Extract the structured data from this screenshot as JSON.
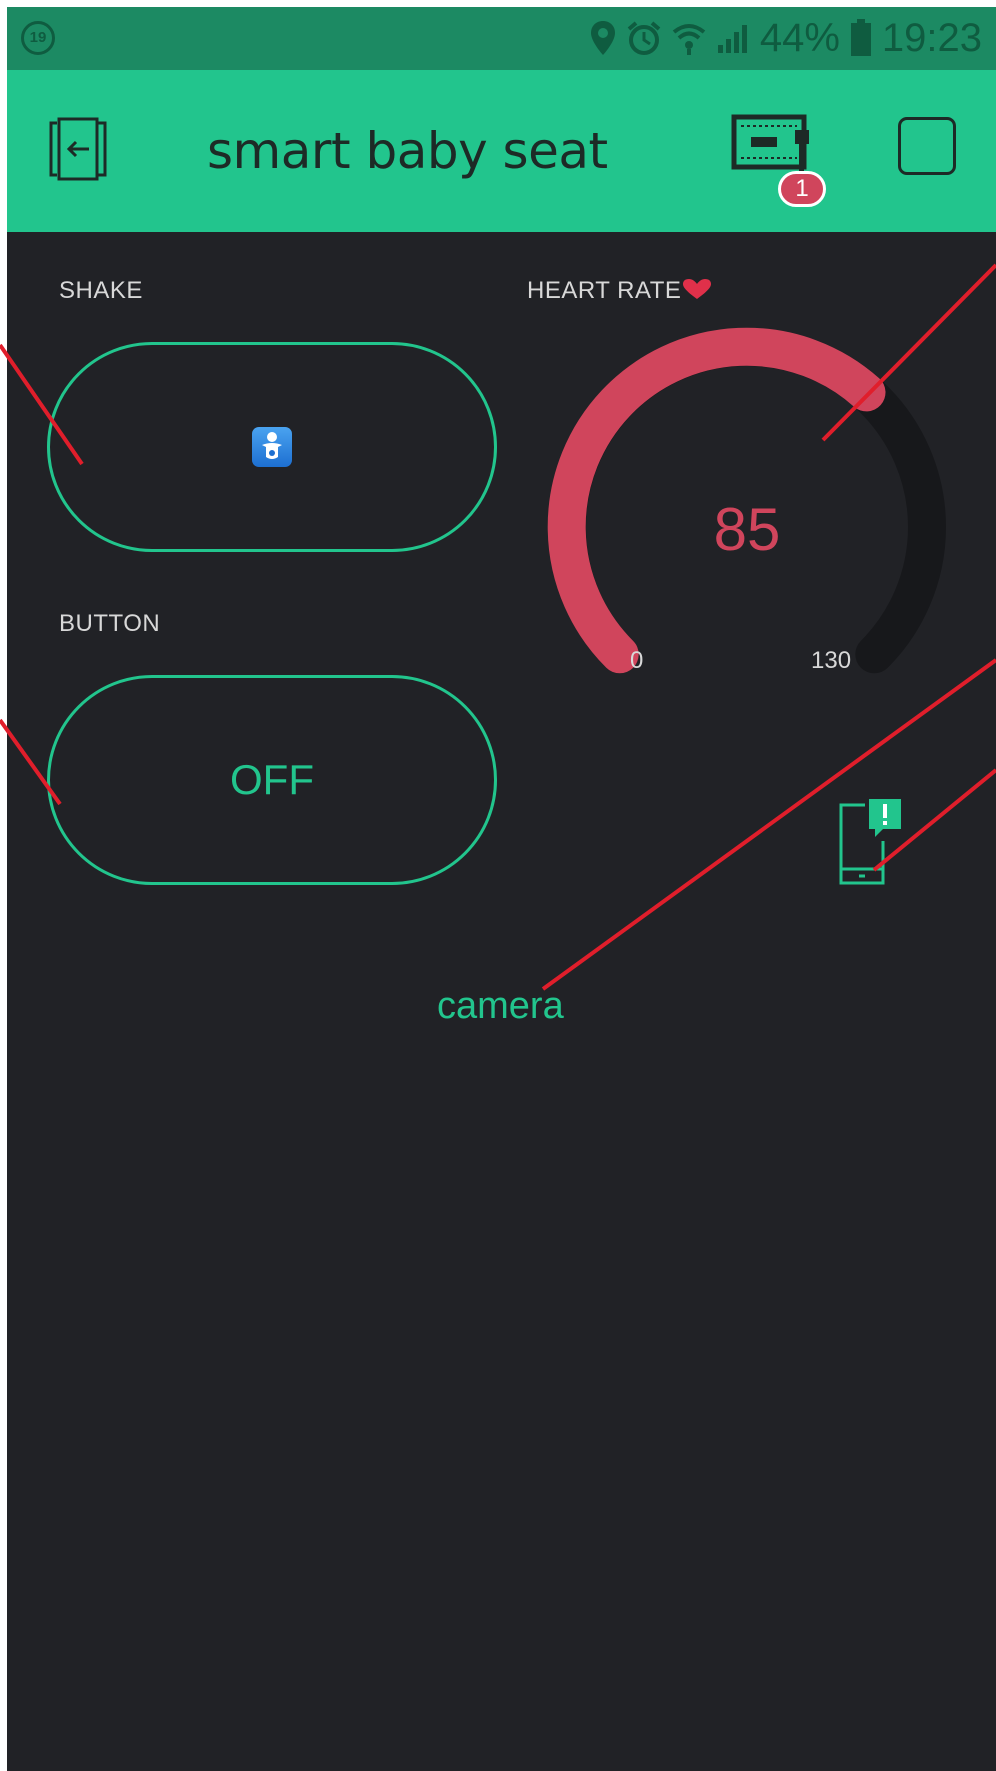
{
  "status_bar": {
    "left_badge": "19",
    "battery": "44%",
    "time": "19:23"
  },
  "app_bar": {
    "title": "smart baby seat",
    "device_badge_count": "1"
  },
  "widgets": {
    "shake": {
      "label": "SHAKE",
      "icon": "baby-symbol-icon"
    },
    "button": {
      "label": "BUTTON",
      "state": "OFF"
    },
    "heart_rate": {
      "label": "HEART RATE",
      "label_icon": "heart-icon",
      "value": "85",
      "min": "0",
      "max": "130",
      "fraction": 0.654
    },
    "notification": {
      "icon": "phone-notification-icon"
    },
    "camera": {
      "text": "camera"
    }
  },
  "colors": {
    "accent": "#22c58d",
    "gauge": "#d0455c",
    "background": "#212226",
    "annotation": "#e01e2b"
  }
}
